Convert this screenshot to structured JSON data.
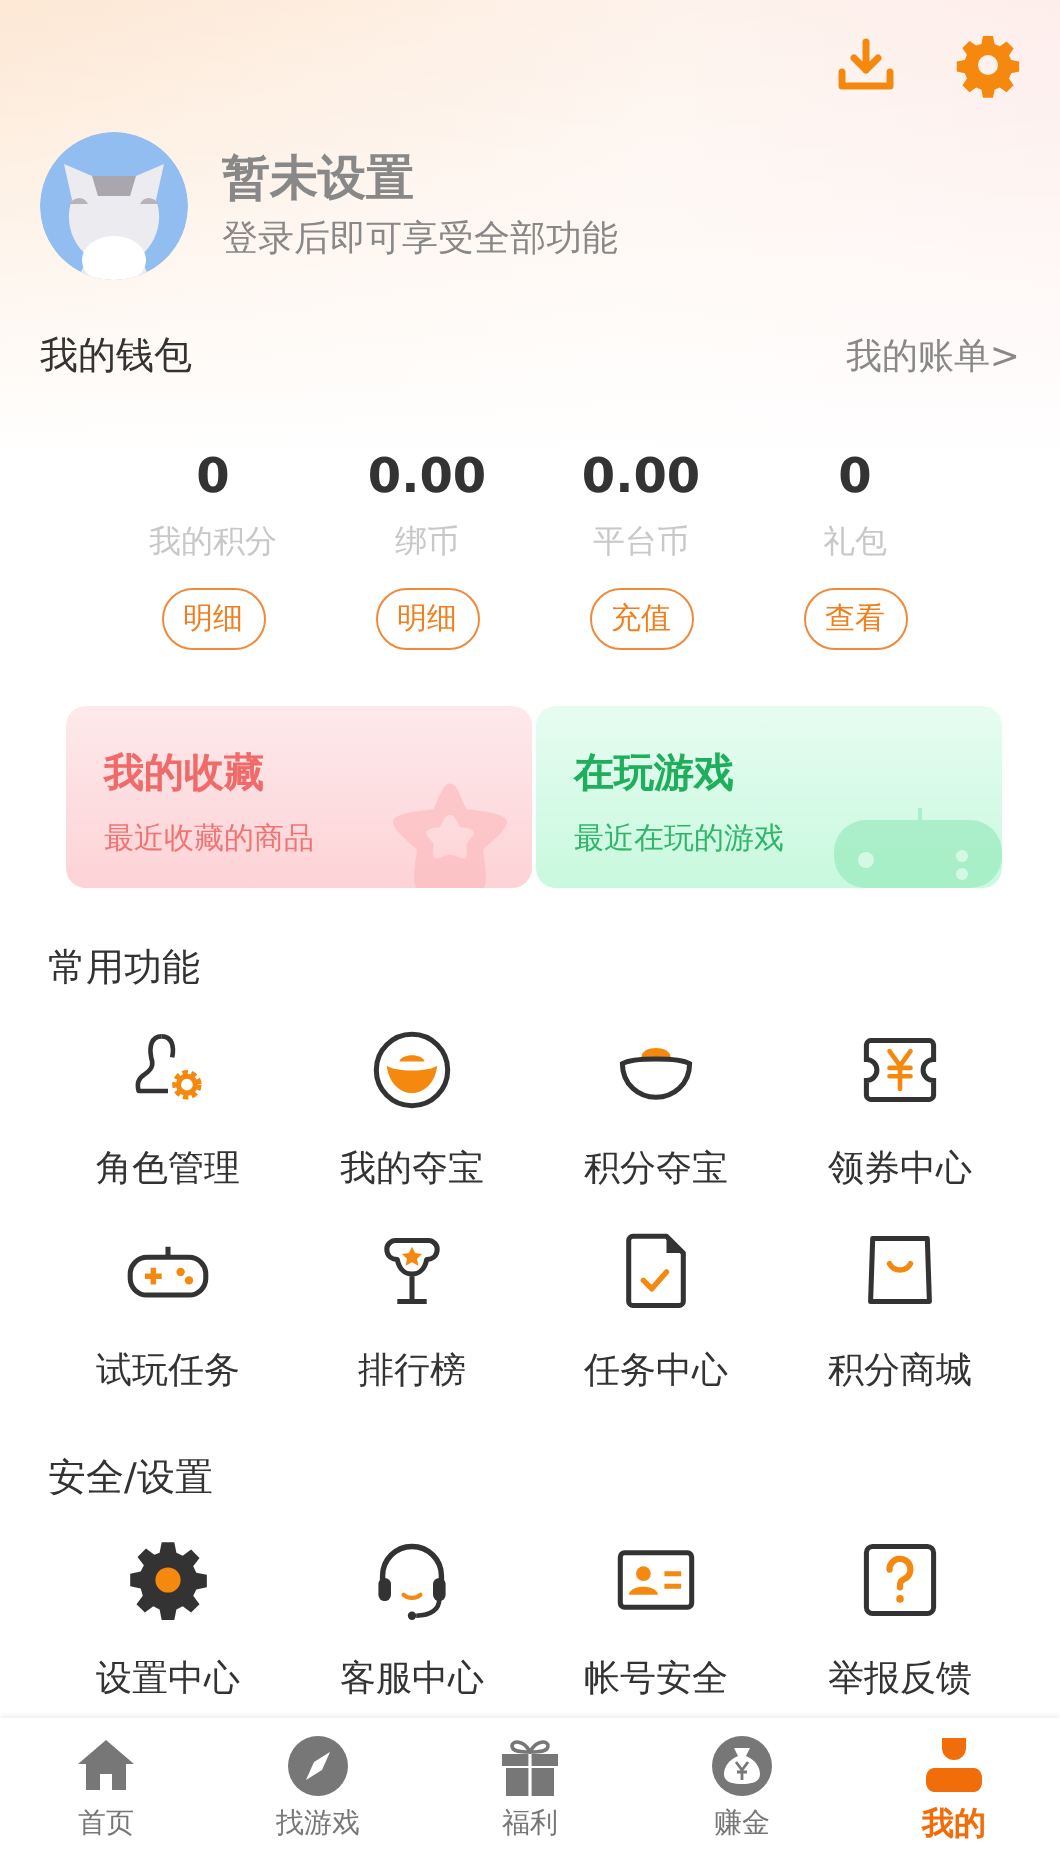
{
  "profile": {
    "name": "暂未设置",
    "subtitle": "登录后即可享受全部功能"
  },
  "wallet": {
    "title": "我的钱包",
    "link": "我的账单>",
    "stats": [
      {
        "value": "0",
        "label": "我的积分",
        "button": "明细"
      },
      {
        "value": "0.00",
        "label": "绑币",
        "button": "明细"
      },
      {
        "value": "0.00",
        "label": "平台币",
        "button": "充值"
      },
      {
        "value": "0",
        "label": "礼包",
        "button": "查看"
      }
    ]
  },
  "cards": [
    {
      "title": "我的收藏",
      "subtitle": "最近收藏的商品",
      "color": "#f06a6a"
    },
    {
      "title": "在玩游戏",
      "subtitle": "最近在玩的游戏",
      "color": "#1fae5c"
    }
  ],
  "sections": [
    {
      "title": "常用功能",
      "items": [
        {
          "label": "角色管理"
        },
        {
          "label": "我的夺宝"
        },
        {
          "label": "积分夺宝"
        },
        {
          "label": "领券中心"
        },
        {
          "label": "试玩任务"
        },
        {
          "label": "排行榜"
        },
        {
          "label": "任务中心"
        },
        {
          "label": "积分商城"
        }
      ]
    },
    {
      "title": "安全/设置",
      "items": [
        {
          "label": "设置中心"
        },
        {
          "label": "客服中心"
        },
        {
          "label": "帐号安全"
        },
        {
          "label": "举报反馈"
        }
      ]
    }
  ],
  "tab_bar": [
    {
      "label": "首页",
      "selected": false
    },
    {
      "label": "找游戏",
      "selected": false
    },
    {
      "label": "福利",
      "selected": false
    },
    {
      "label": "赚金",
      "selected": false
    },
    {
      "label": "我的",
      "selected": true
    }
  ]
}
